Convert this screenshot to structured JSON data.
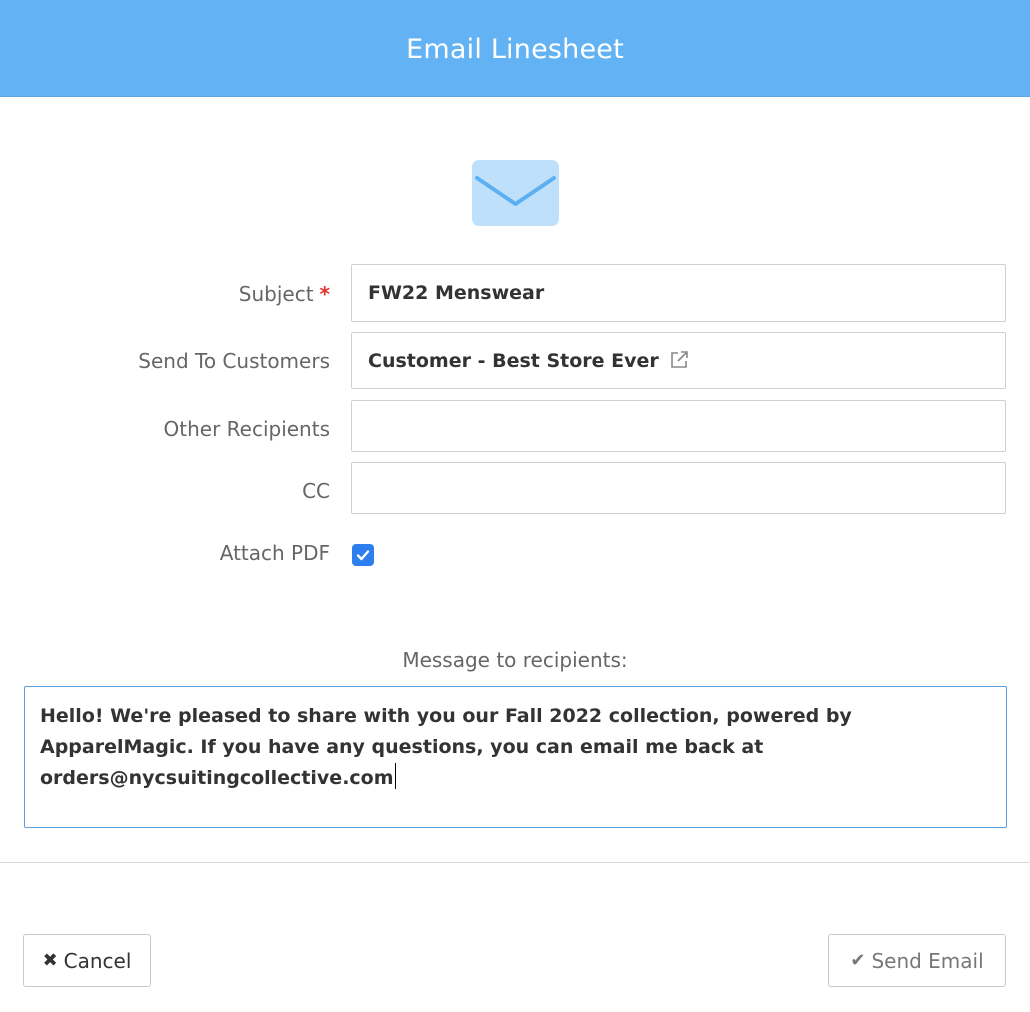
{
  "dialog": {
    "title": "Email Linesheet",
    "header_color": "#63b3f4"
  },
  "icons": {
    "mail": "envelope-icon",
    "external_link": "external-link-icon",
    "cancel": "times-icon",
    "send": "check-icon"
  },
  "form": {
    "subject": {
      "label": "Subject",
      "required_marker": "*",
      "value": "FW22 Menswear"
    },
    "send_to_customers": {
      "label": "Send To Customers",
      "value": "Customer - Best Store Ever"
    },
    "other_recipients": {
      "label": "Other Recipients",
      "value": ""
    },
    "cc": {
      "label": "CC",
      "value": ""
    },
    "attach_pdf": {
      "label": "Attach PDF",
      "checked": true
    }
  },
  "message": {
    "label": "Message to recipients:",
    "value": "Hello! We're pleased to share with you our Fall 2022 collection, powered by ApparelMagic. If you have any questions, you can email me back at orders@nycsuitingcollective.com"
  },
  "footer": {
    "cancel_label": "Cancel",
    "send_label": "Send Email"
  },
  "colors": {
    "accent": "#2d7ff0",
    "required": "#e0322b"
  }
}
